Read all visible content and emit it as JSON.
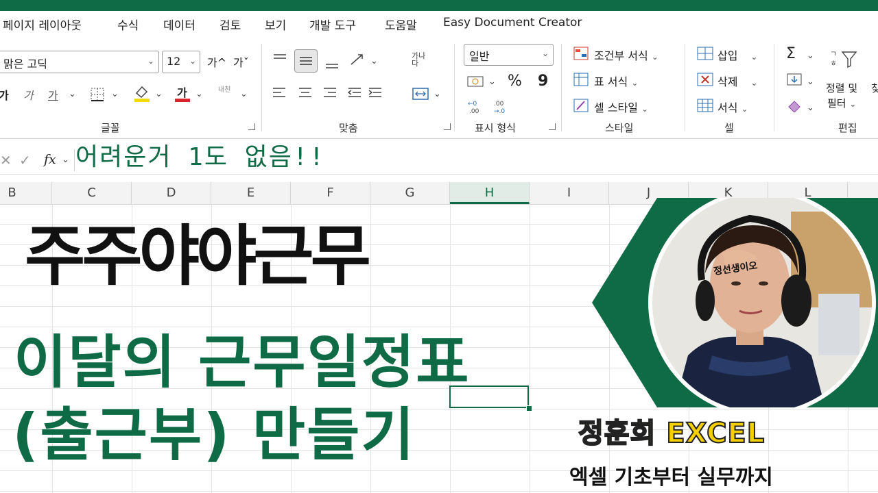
{
  "menu": [
    "페이지 레이아웃",
    "수식",
    "데이터",
    "검토",
    "보기",
    "개발 도구",
    "도움말",
    "Easy Document Creator"
  ],
  "ribbon": {
    "font_name": "맑은 고딕",
    "font_size": "12",
    "grow_font": "가^",
    "shrink_font": "가ˇ",
    "bold": "가",
    "italic": "가",
    "underline": "가",
    "font_color_glyph": "가",
    "phonetic": "내천",
    "wrap_text": "가나다",
    "number_format": "일반",
    "percent": "%",
    "comma": "9",
    "conditional": "조건부 서식",
    "format_table": "표 서식",
    "cell_style": "셀 스타일",
    "insert": "삽입",
    "delete": "삭제",
    "format": "서식",
    "sum": "Σ",
    "sort_filter_1": "정렬 및",
    "sort_filter_2": "필터",
    "find": "찾",
    "groups": {
      "font": "글꼴",
      "align": "맞춤",
      "number": "표시 형식",
      "style": "스타일",
      "cells": "셀",
      "edit": "편집"
    },
    "colors": {
      "font_fill": "#f2d90a",
      "font_color": "#d9242b",
      "accent": "#0f6b46"
    }
  },
  "formula_bar": {
    "fx": "fx"
  },
  "columns": [
    "B",
    "C",
    "D",
    "E",
    "F",
    "G",
    "H",
    "I",
    "J",
    "K",
    "L"
  ],
  "selected_column": "H",
  "overlay": {
    "handwritten": "어려운거 1도 없음!!",
    "title_main": "주주야야근무",
    "title_line2": "이달의 근무일정표",
    "title_line3": "(출근부) 만들기",
    "brand": "정훈희 EXCEL",
    "brand_sub": "엑셀 기초부터 실무까지",
    "photo_caption": "정선생이오"
  }
}
